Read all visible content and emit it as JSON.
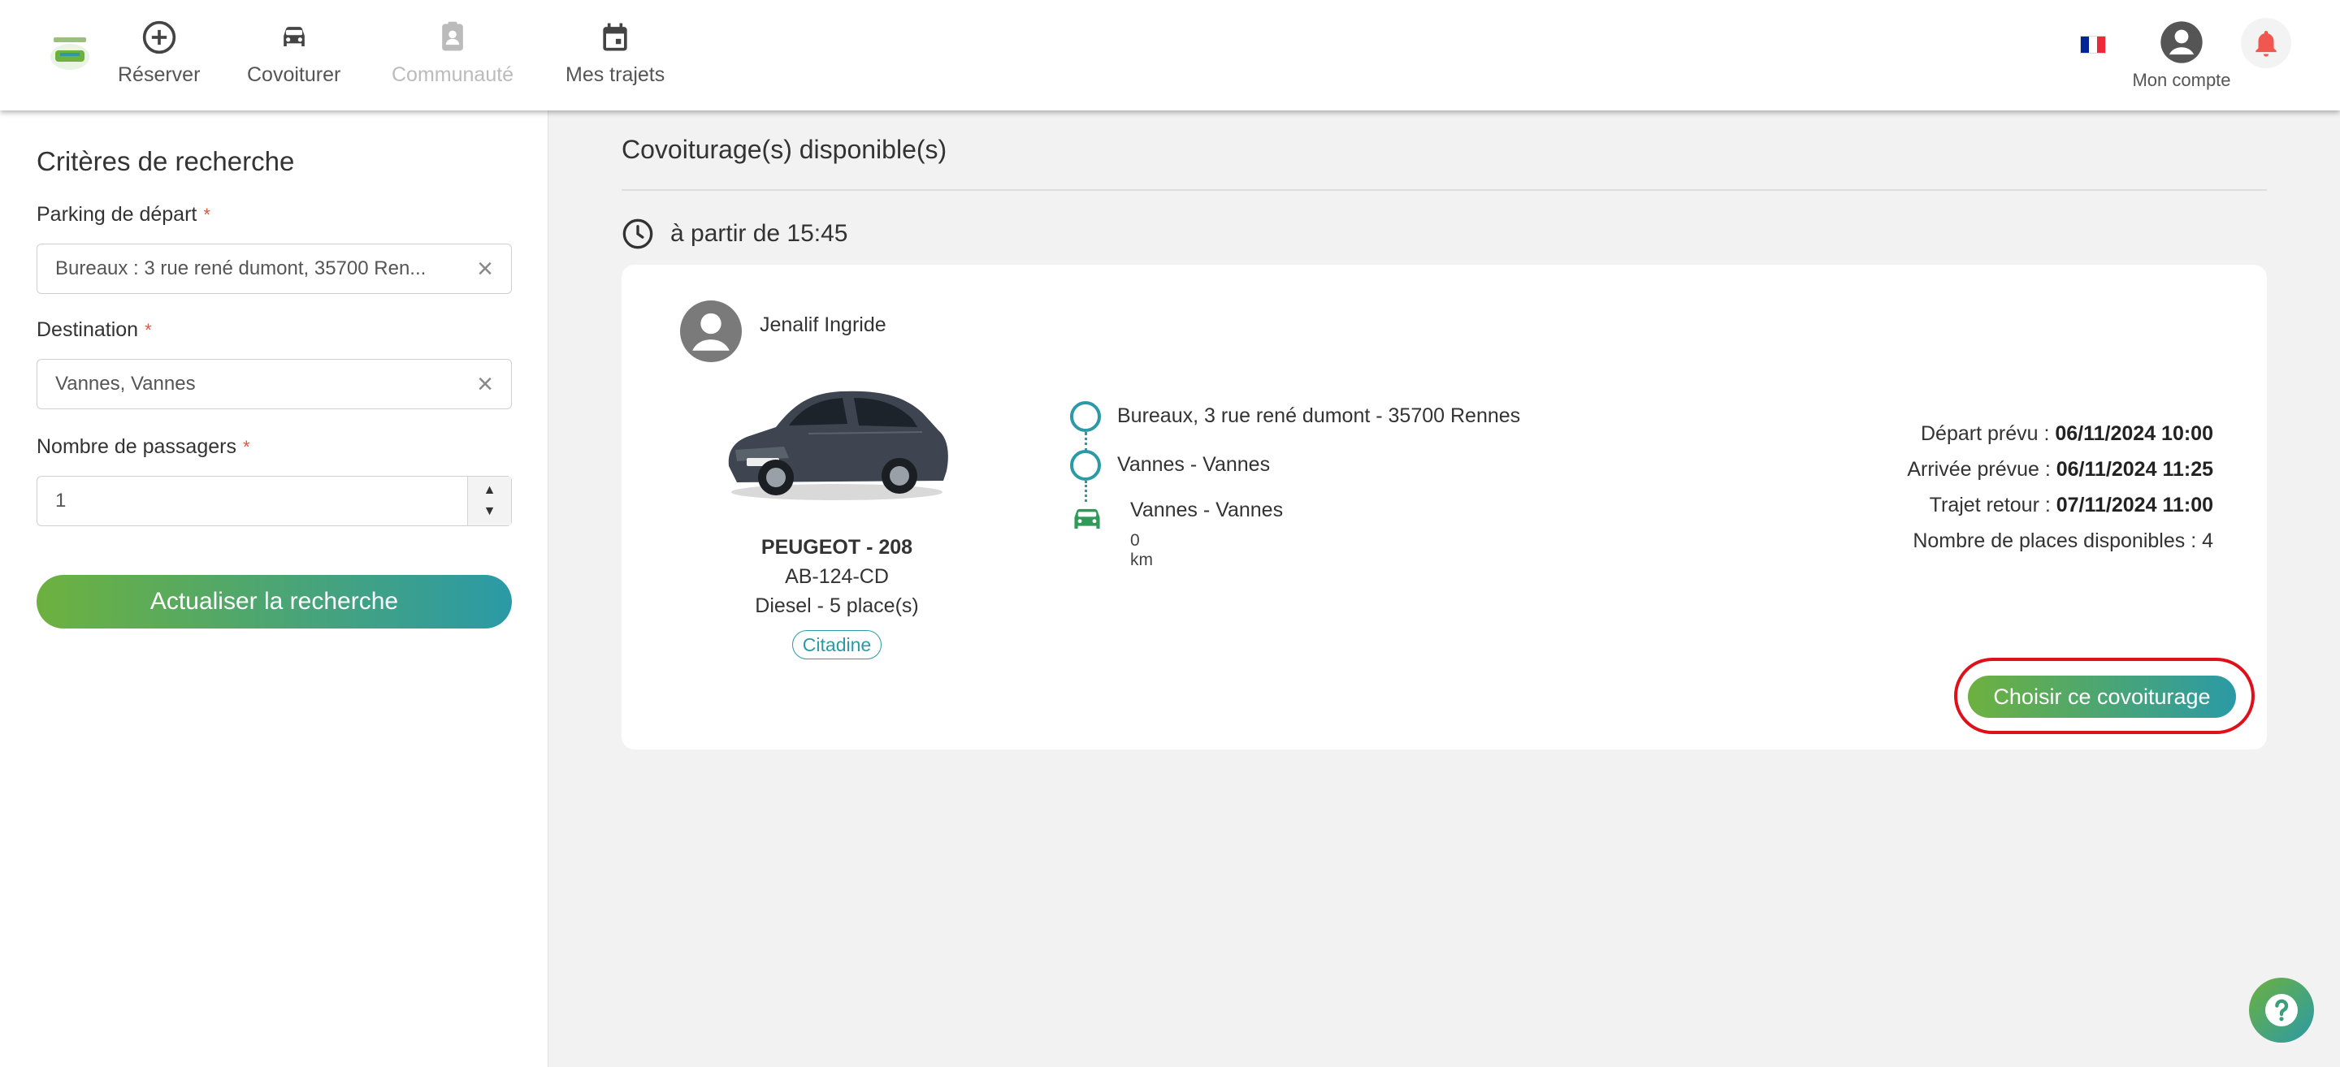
{
  "header": {
    "nav": [
      {
        "label": "Réserver",
        "icon": "plus-circle-icon"
      },
      {
        "label": "Covoiturer",
        "icon": "car-icon"
      },
      {
        "label": "Communauté",
        "icon": "community-icon",
        "disabled": true
      },
      {
        "label": "Mes trajets",
        "icon": "calendar-icon"
      }
    ],
    "account_label": "Mon compte",
    "flag_colors": [
      "#002395",
      "#ffffff",
      "#ed2939"
    ],
    "bell_color": "#f0584f"
  },
  "sidebar": {
    "title": "Critères de recherche",
    "departure": {
      "label": "Parking de départ",
      "value": "Bureaux : 3 rue rené dumont, 35700 Ren..."
    },
    "destination": {
      "label": "Destination",
      "value": "Vannes, Vannes"
    },
    "passengers": {
      "label": "Nombre de passagers",
      "value": "1"
    },
    "required_mark": "*",
    "refresh_button": "Actualiser la recherche"
  },
  "main": {
    "title": "Covoiturage(s) disponible(s)",
    "time_label": "à partir de 15:45",
    "card": {
      "driver_name": "Jenalif Ingride",
      "car_model": "PEUGEOT - 208",
      "car_plate": "AB-124-CD",
      "car_info": "Diesel - 5 place(s)",
      "car_category": "Citadine",
      "route": {
        "start": "Bureaux, 3 rue rené dumont - 35700 Rennes",
        "stop": "Vannes - Vannes",
        "destination": "Vannes - Vannes",
        "distance": "0 km"
      },
      "details": {
        "depart_label": "Départ prévu :",
        "depart_value": "06/11/2024 10:00",
        "arrival_label": "Arrivée prévue :",
        "arrival_value": "06/11/2024 11:25",
        "return_label": "Trajet retour :",
        "return_value": "07/11/2024 11:00",
        "seats_label": "Nombre de places disponibles : 4"
      },
      "choose_button": "Choisir ce covoiturage"
    }
  },
  "colors": {
    "accent_green": "#6db13f",
    "accent_teal": "#2b9aa6",
    "highlight_red": "#e0101a"
  }
}
